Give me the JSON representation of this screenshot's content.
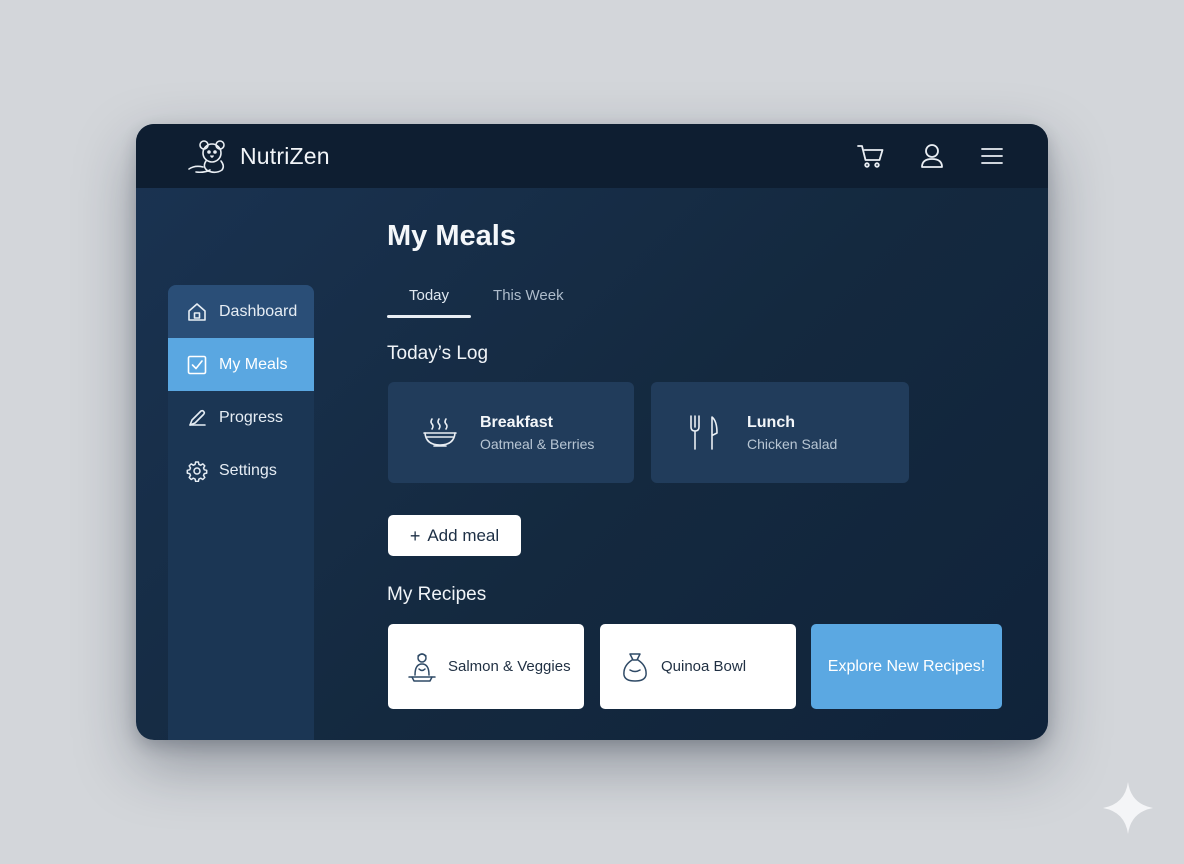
{
  "app": {
    "name": "NutriZen"
  },
  "header": {
    "icons": [
      "cart-icon",
      "user-icon",
      "menu-icon"
    ]
  },
  "sidebar": {
    "items": [
      {
        "label": "Dashboard",
        "icon": "home-icon"
      },
      {
        "label": "My Meals",
        "icon": "checkbox-icon",
        "active": true
      },
      {
        "label": "Progress",
        "icon": "pen-icon"
      },
      {
        "label": "Settings",
        "icon": "gear-icon"
      }
    ]
  },
  "main": {
    "title": "My Meals",
    "tabs": [
      {
        "label": "Today",
        "active": true
      },
      {
        "label": "This Week"
      }
    ],
    "log": {
      "title": "Today’s Log",
      "meals": [
        {
          "name": "Breakfast",
          "description": "Oatmeal & Berries",
          "icon": "bowl-icon"
        },
        {
          "name": "Lunch",
          "description": "Chicken Salad",
          "icon": "fork-knife-icon"
        }
      ],
      "add_button": {
        "symbol": "+",
        "label": "Add meal"
      }
    },
    "recipes": {
      "title": "My Recipes",
      "items": [
        {
          "label": "Salmon & Veggies",
          "icon": "chef-icon"
        },
        {
          "label": "Quinoa Bowl",
          "icon": "sack-icon"
        }
      ],
      "explore_label": "Explore New Recipes!"
    }
  },
  "colors": {
    "page_background": "#d3d6da",
    "app_background": "#14293f",
    "topbar": "#0e1e31",
    "sidebar": "#1b3654",
    "accent": "#5aa7e1",
    "card": "#213c5b"
  }
}
